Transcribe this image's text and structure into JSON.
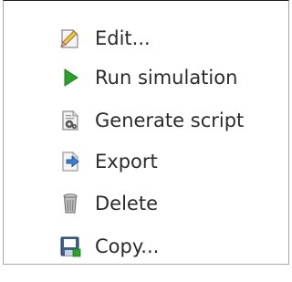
{
  "menu": {
    "items": [
      {
        "label": "Edit...",
        "icon": "edit-icon"
      },
      {
        "label": "Run simulation",
        "icon": "play-icon"
      },
      {
        "label": "Generate script",
        "icon": "script-icon"
      },
      {
        "label": "Export",
        "icon": "export-icon"
      },
      {
        "label": "Delete",
        "icon": "trash-icon"
      },
      {
        "label": "Copy...",
        "icon": "copy-icon"
      }
    ]
  },
  "colors": {
    "text": "#2b2b2b",
    "play_green": "#2aa12a",
    "export_blue": "#3b7fd4",
    "border": "#a8a8a8"
  }
}
